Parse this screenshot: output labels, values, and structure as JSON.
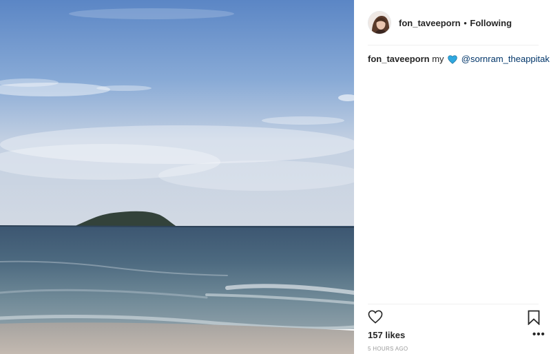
{
  "post": {
    "author": {
      "username": "fon_taveeporn",
      "separator": "•",
      "follow_status": "Following"
    },
    "caption": {
      "username": "fon_taveeporn",
      "text_before_emoji": "my",
      "emoji": "blue-heart",
      "mention": "@sornram_theappitak"
    },
    "likes": "157 likes",
    "timestamp": "5 HOURS AGO",
    "more_options": "•••"
  },
  "icons": {
    "like": "heart-outline-icon",
    "save": "bookmark-outline-icon",
    "caption_emoji": "blue-heart-icon"
  },
  "colors": {
    "text": "#262626",
    "mention": "#003569",
    "muted": "#999999",
    "divider": "#efefef",
    "blue_heart": "#2fa8e0"
  }
}
